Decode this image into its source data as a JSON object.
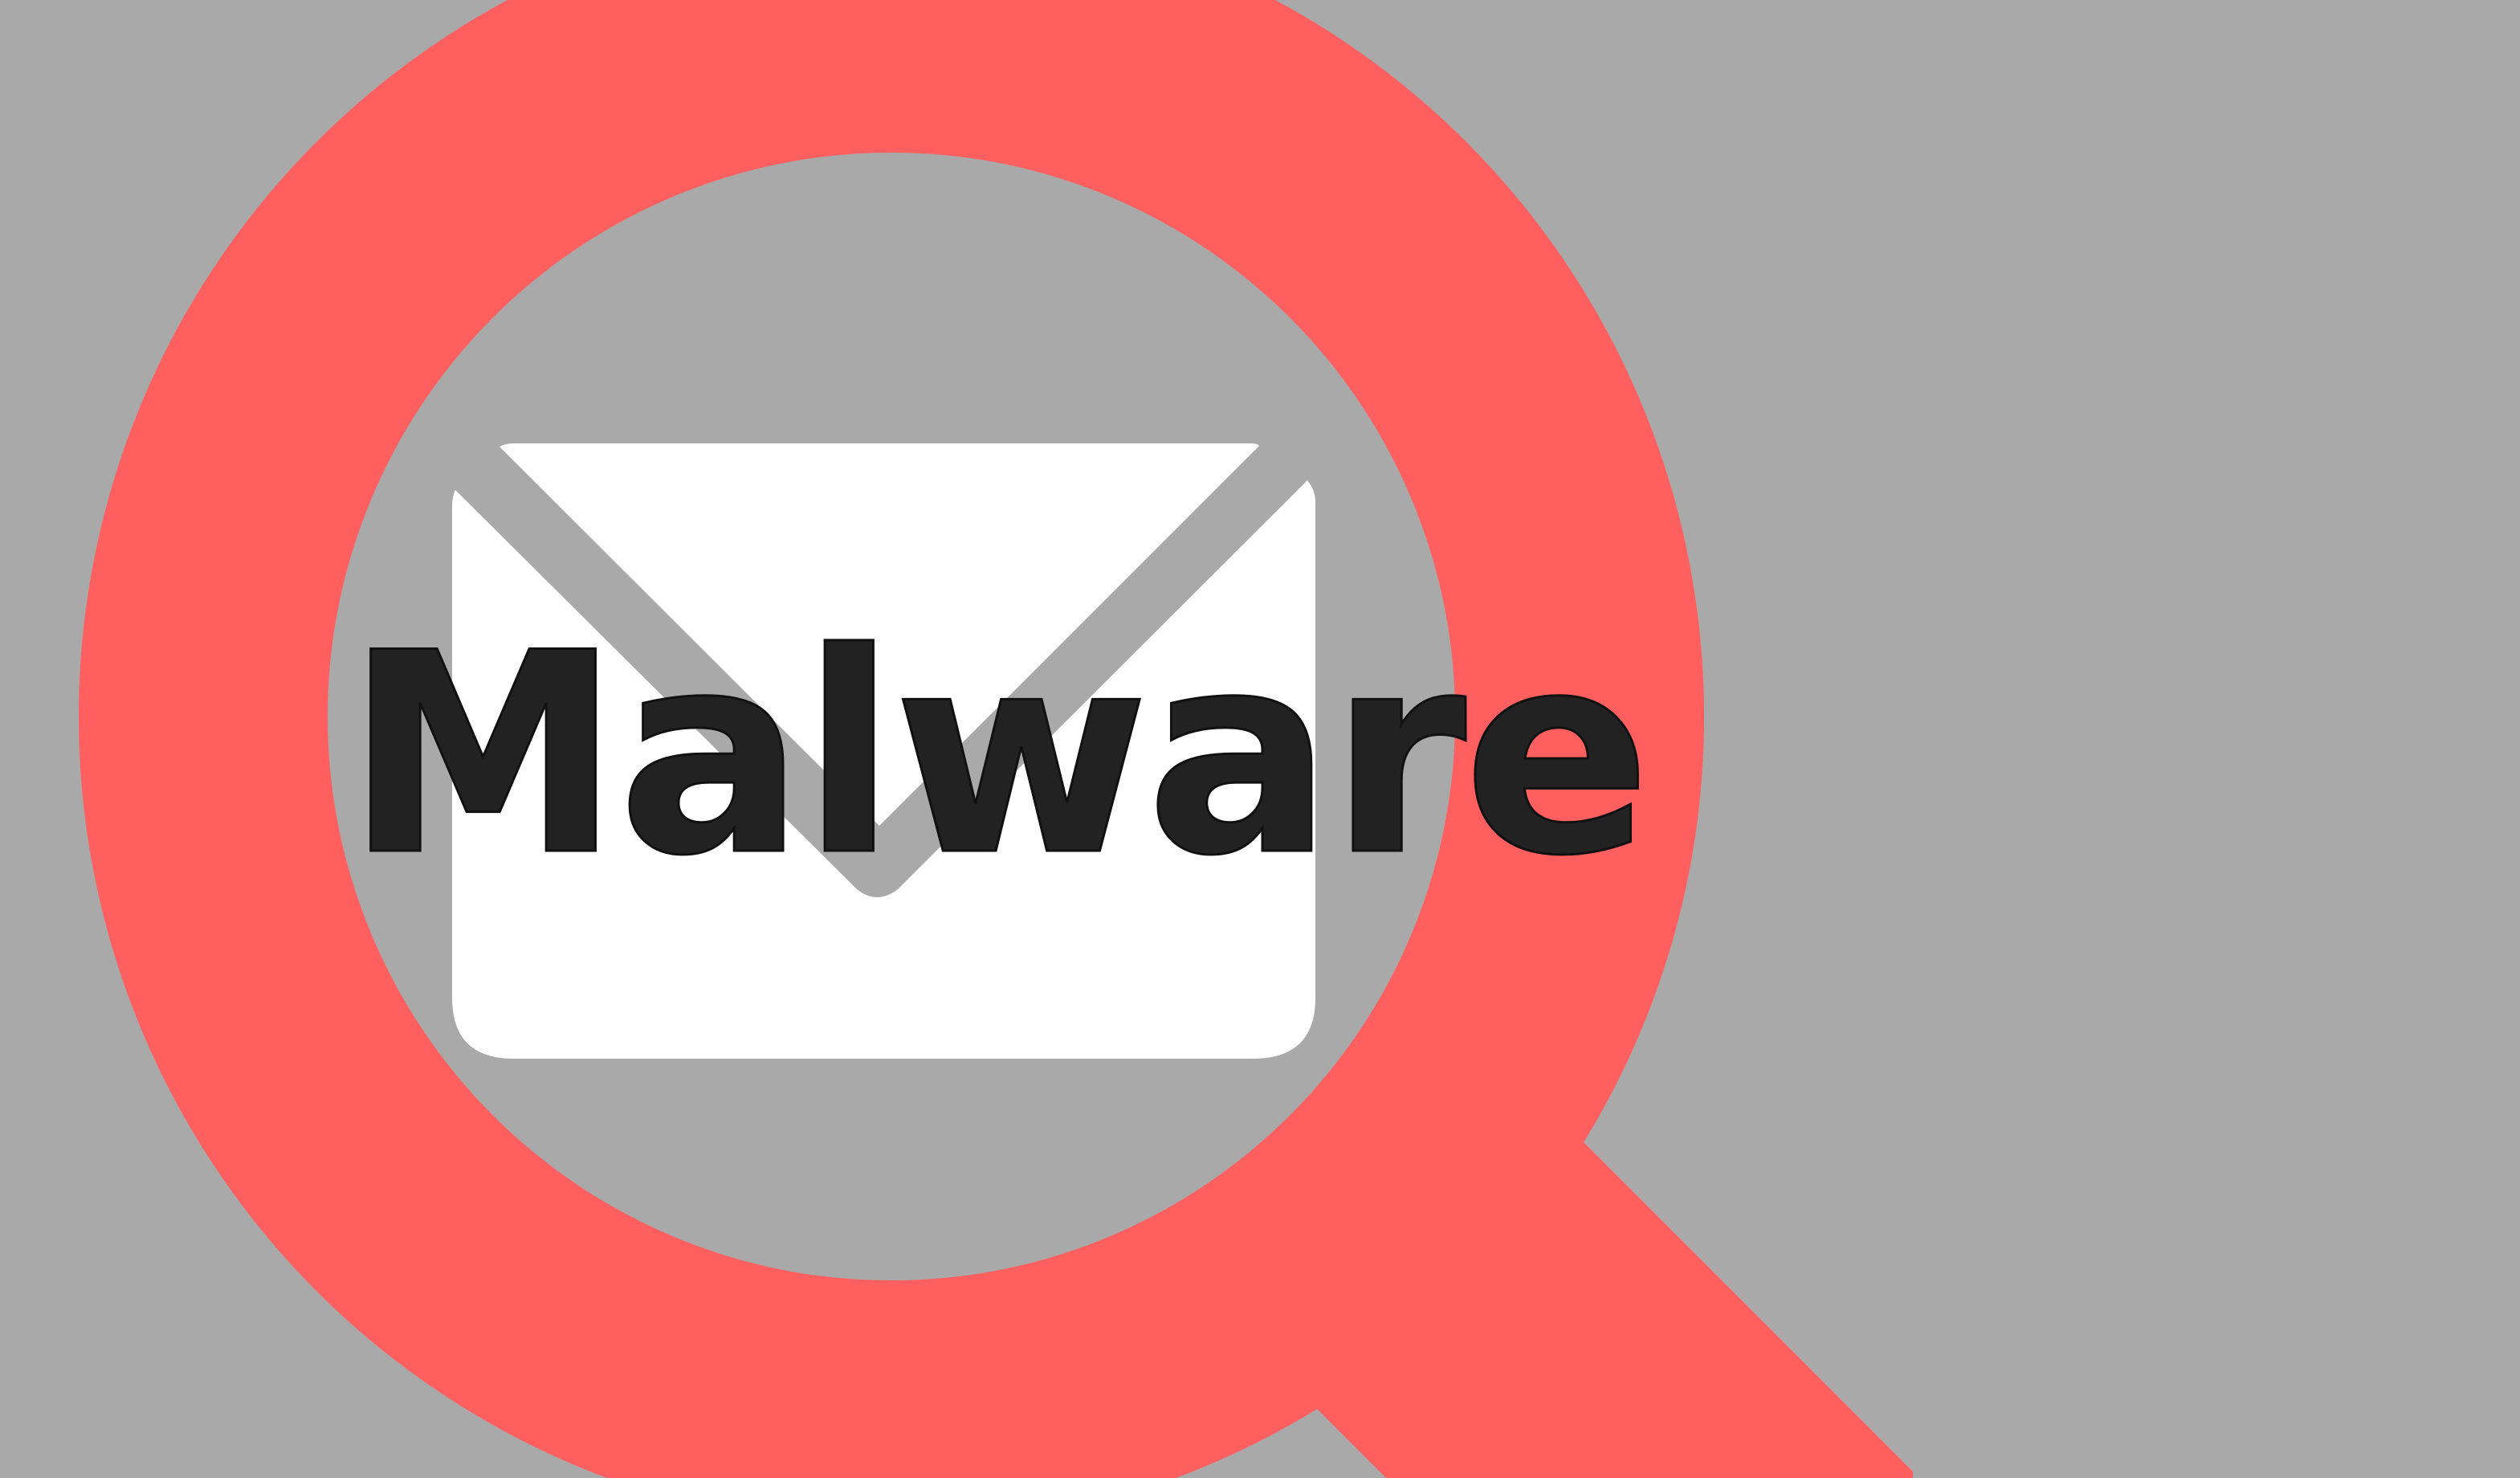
{
  "headline": "Malware",
  "icons": {
    "magnifier": "magnifying-glass-icon",
    "envelope": "envelope-icon"
  },
  "colors": {
    "background": "#a9a9a9",
    "magnifier": "#ff5f5f",
    "envelope": "#ffffff",
    "text": "#222222"
  }
}
